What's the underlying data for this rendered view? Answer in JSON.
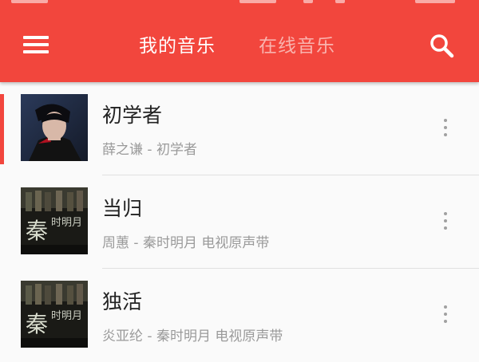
{
  "theme": {
    "accent": "#f2463d",
    "tab_inactive": "#f9b3ae",
    "title_text": "#222222",
    "subtitle_text": "#9a9a9a"
  },
  "header": {
    "menu_icon": "menu-icon",
    "tabs": [
      {
        "label": "我的音乐",
        "active": true
      },
      {
        "label": "在线音乐",
        "active": false
      }
    ],
    "search_icon": "search-icon"
  },
  "songs": [
    {
      "title": "初学者",
      "subtitle": "薛之谦 - 初学者",
      "playing": true,
      "cover": "portrait-cover"
    },
    {
      "title": "当归",
      "subtitle": "周蕙 - 秦时明月 电视原声带",
      "playing": false,
      "cover": "qin-shi-ming-yue-cover"
    },
    {
      "title": "独活",
      "subtitle": "炎亚纶 - 秦时明月 电视原声带",
      "playing": false,
      "cover": "qin-shi-ming-yue-cover"
    }
  ]
}
